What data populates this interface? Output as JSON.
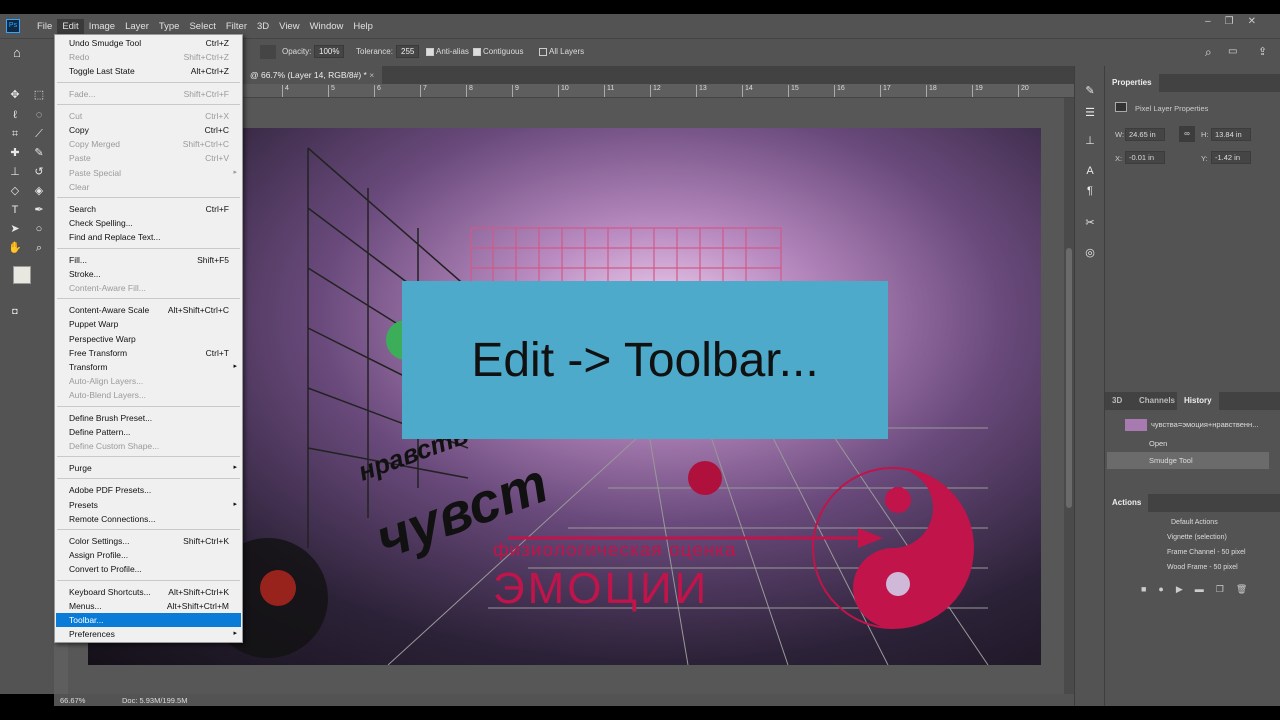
{
  "menubar": {
    "logo": "Ps",
    "items": [
      "File",
      "Edit",
      "Image",
      "Layer",
      "Type",
      "Select",
      "Filter",
      "3D",
      "View",
      "Window",
      "Help"
    ]
  },
  "options": {
    "opacity_label": "Opacity:",
    "opacity": "100%",
    "tolerance_label": "Tolerance:",
    "tolerance": "255",
    "anti_alias": "Anti-alias",
    "contiguous": "Contiguous",
    "all_layers": "All Layers"
  },
  "document_tab": {
    "title": "@ 66.7% (Layer 14, RGB/8#) *",
    "close": "×"
  },
  "ruler_ticks": [
    "4",
    "5",
    "6",
    "7",
    "8",
    "9",
    "10",
    "11",
    "12",
    "13",
    "14",
    "15",
    "16",
    "17",
    "18",
    "19",
    "20"
  ],
  "status": {
    "zoom": "66.67%",
    "doc": "Doc: 5.93M/199.5M"
  },
  "edit_menu": [
    {
      "label": "Undo Smudge Tool",
      "shortcut": "Ctrl+Z"
    },
    {
      "label": "Redo",
      "shortcut": "Shift+Ctrl+Z",
      "disabled": true
    },
    {
      "label": "Toggle Last State",
      "shortcut": "Alt+Ctrl+Z"
    },
    {
      "sep": true
    },
    {
      "label": "Fade...",
      "shortcut": "Shift+Ctrl+F",
      "disabled": true
    },
    {
      "sep": true
    },
    {
      "label": "Cut",
      "shortcut": "Ctrl+X",
      "disabled": true
    },
    {
      "label": "Copy",
      "shortcut": "Ctrl+C"
    },
    {
      "label": "Copy Merged",
      "shortcut": "Shift+Ctrl+C",
      "disabled": true
    },
    {
      "label": "Paste",
      "shortcut": "Ctrl+V",
      "disabled": true
    },
    {
      "label": "Paste Special",
      "submenu": true,
      "disabled": true
    },
    {
      "label": "Clear",
      "disabled": true
    },
    {
      "sep": true
    },
    {
      "label": "Search",
      "shortcut": "Ctrl+F"
    },
    {
      "label": "Check Spelling..."
    },
    {
      "label": "Find and Replace Text..."
    },
    {
      "sep": true
    },
    {
      "label": "Fill...",
      "shortcut": "Shift+F5"
    },
    {
      "label": "Stroke..."
    },
    {
      "label": "Content-Aware Fill...",
      "disabled": true
    },
    {
      "sep": true
    },
    {
      "label": "Content-Aware Scale",
      "shortcut": "Alt+Shift+Ctrl+C"
    },
    {
      "label": "Puppet Warp"
    },
    {
      "label": "Perspective Warp"
    },
    {
      "label": "Free Transform",
      "shortcut": "Ctrl+T"
    },
    {
      "label": "Transform",
      "submenu": true
    },
    {
      "label": "Auto-Align Layers...",
      "disabled": true
    },
    {
      "label": "Auto-Blend Layers...",
      "disabled": true
    },
    {
      "sep": true
    },
    {
      "label": "Define Brush Preset..."
    },
    {
      "label": "Define Pattern..."
    },
    {
      "label": "Define Custom Shape...",
      "disabled": true
    },
    {
      "sep": true
    },
    {
      "label": "Purge",
      "submenu": true
    },
    {
      "sep": true
    },
    {
      "label": "Adobe PDF Presets..."
    },
    {
      "label": "Presets",
      "submenu": true
    },
    {
      "label": "Remote Connections..."
    },
    {
      "sep": true
    },
    {
      "label": "Color Settings...",
      "shortcut": "Shift+Ctrl+K"
    },
    {
      "label": "Assign Profile..."
    },
    {
      "label": "Convert to Profile..."
    },
    {
      "sep": true
    },
    {
      "label": "Keyboard Shortcuts...",
      "shortcut": "Alt+Shift+Ctrl+K"
    },
    {
      "label": "Menus...",
      "shortcut": "Alt+Shift+Ctrl+M"
    },
    {
      "label": "Toolbar...",
      "highlighted": true
    },
    {
      "label": "Preferences",
      "submenu": true
    }
  ],
  "overlay": {
    "text": "Edit -> Toolbar..."
  },
  "artwork": {
    "line1": "нравств",
    "line2": "чувст",
    "line3": "физиологическая оценка",
    "line4": "ЭМОЦИИ"
  },
  "properties": {
    "tab": "Properties",
    "subtitle": "Pixel Layer Properties",
    "w_label": "W:",
    "w": "24.65 in",
    "h_label": "H:",
    "h": "13.84 in",
    "x_label": "X:",
    "x": "-0.01 in",
    "y_label": "Y:",
    "y": "-1.42 in"
  },
  "history": {
    "tabs": [
      "3D",
      "Channels",
      "History"
    ],
    "snapshot": "чувства=эмоция+нравственн...",
    "items": [
      "Open",
      "Smudge Tool"
    ]
  },
  "actions": {
    "tab": "Actions",
    "items": [
      "Default Actions",
      "Vignette (selection)",
      "Frame Channel - 50 pixel",
      "Wood Frame - 50 pixel"
    ]
  },
  "colors": {
    "accent": "#0a7cd8",
    "overlay": "#4eaacb",
    "crimson": "#c0144a"
  }
}
